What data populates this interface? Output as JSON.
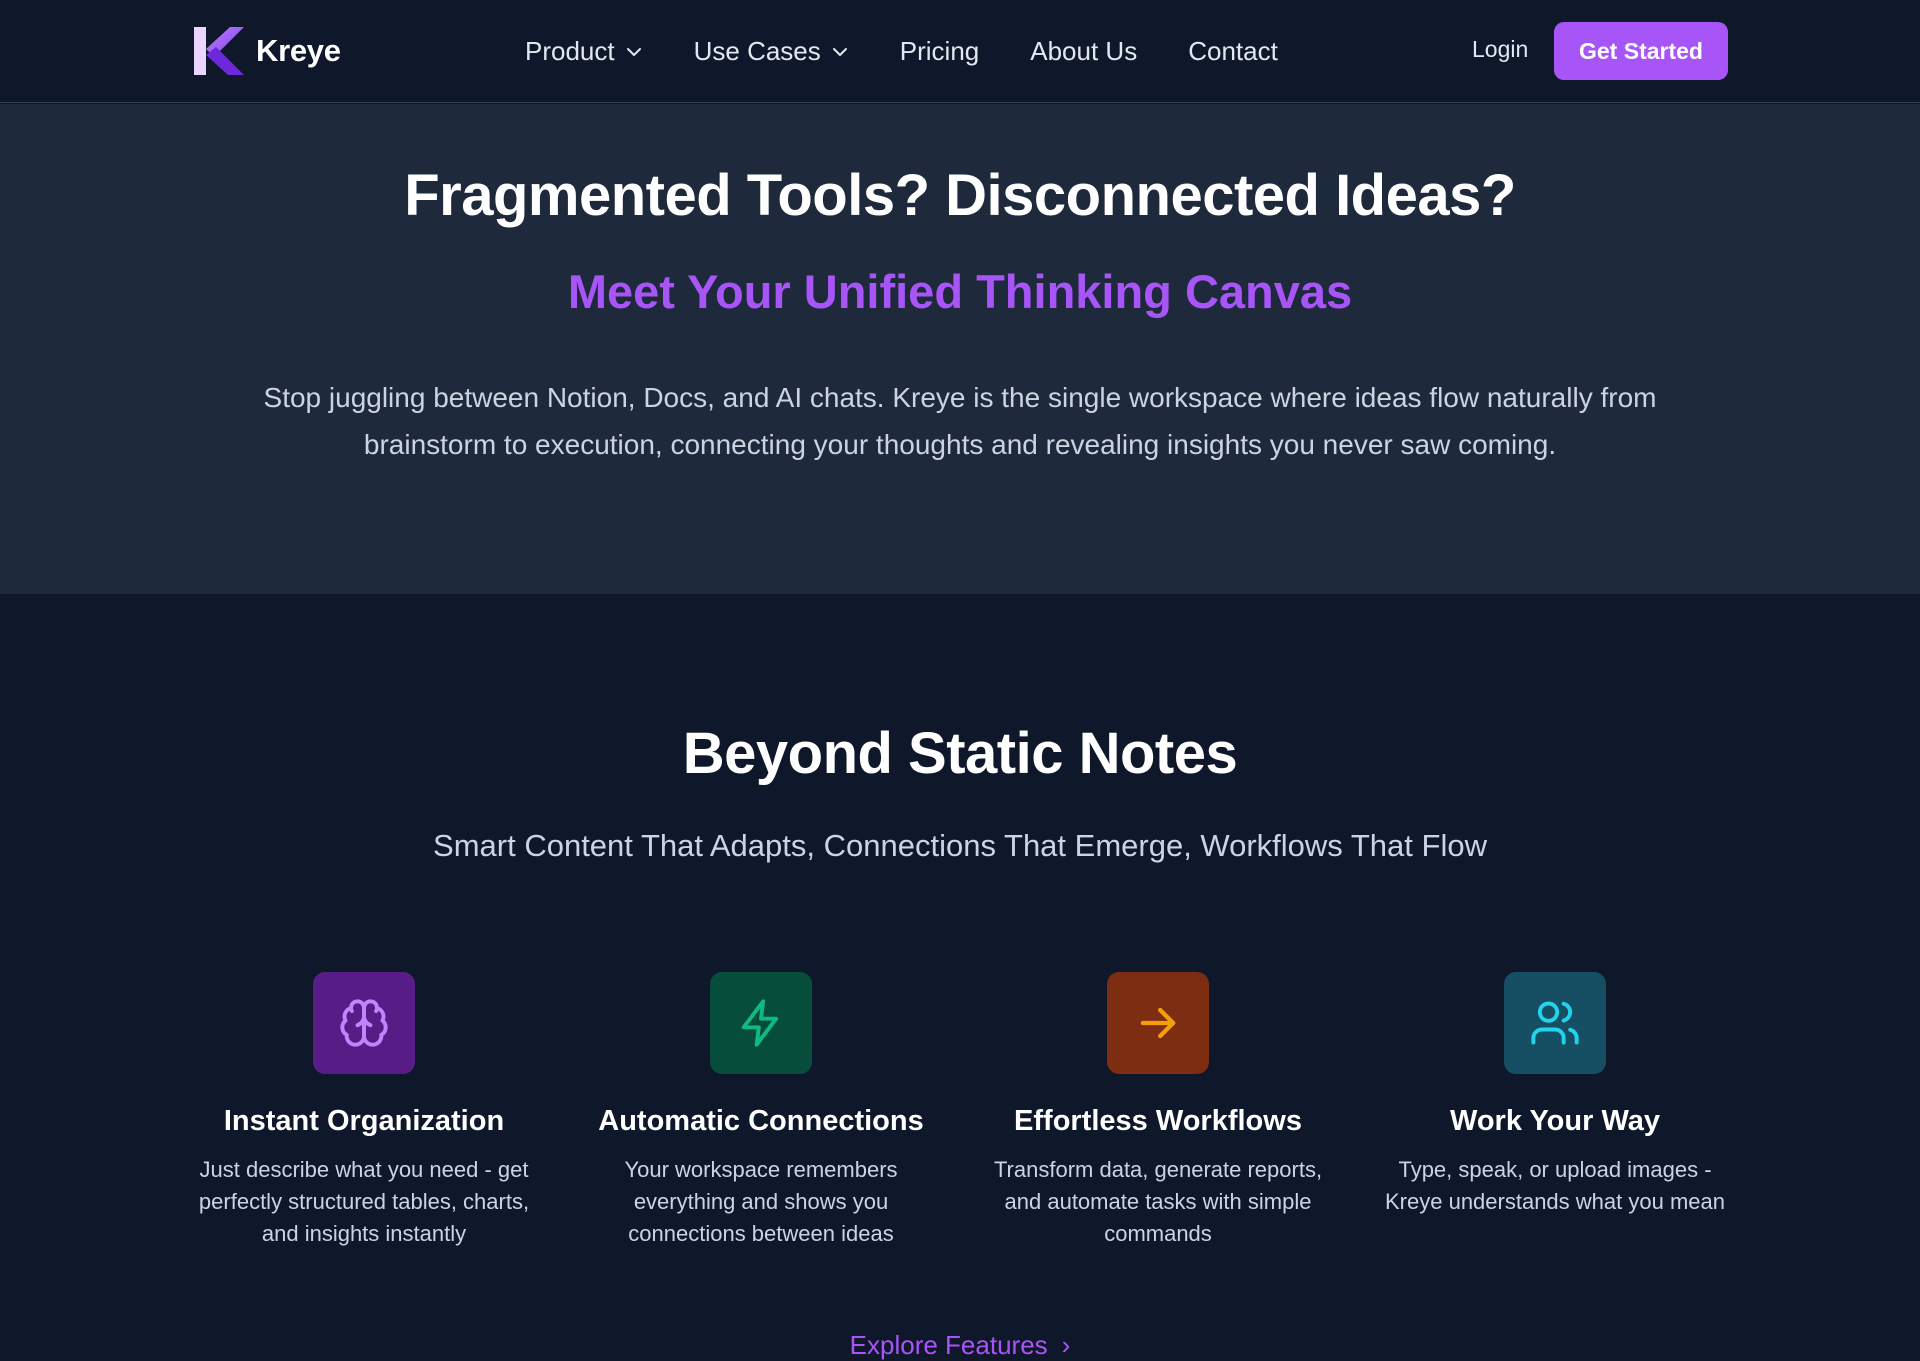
{
  "nav": {
    "brand": "Kreye",
    "items": [
      {
        "label": "Product"
      },
      {
        "label": "Use Cases"
      },
      {
        "label": "Pricing"
      },
      {
        "label": "About Us"
      },
      {
        "label": "Contact"
      }
    ],
    "login": "Login",
    "cta": "Get Started"
  },
  "hero": {
    "title": "Fragmented Tools? Disconnected Ideas?",
    "subtitle": "Meet Your Unified Thinking Canvas",
    "description": "Stop juggling between Notion, Docs, and AI chats. Kreye is the single workspace where ideas flow naturally from brainstorm to execution, connecting your thoughts and revealing insights you never saw coming."
  },
  "features": {
    "title": "Beyond Static Notes",
    "subtitle": "Smart Content That Adapts, Connections That Emerge, Workflows That Flow",
    "cards": [
      {
        "icon": "brain-icon",
        "title": "Instant Organization",
        "text": "Just describe what you need - get perfectly structured tables, charts, and insights instantly",
        "icon_color": "#c084fc",
        "box_color": "#581c87"
      },
      {
        "icon": "lightning-icon",
        "title": "Automatic Connections",
        "text": "Your workspace remembers everything and shows you connections between ideas",
        "icon_color": "#10b981",
        "box_color": "#064e3b"
      },
      {
        "icon": "arrow-right-icon",
        "title": "Effortless Workflows",
        "text": "Transform data, generate reports, and automate tasks with simple commands",
        "icon_color": "#f59e0b",
        "box_color": "#7c2d12"
      },
      {
        "icon": "users-icon",
        "title": "Work Your Way",
        "text": "Type, speak, or upload images - Kreye understands what you mean",
        "icon_color": "#22d3ee",
        "box_color": "#164e63"
      }
    ],
    "explore": "Explore Features"
  },
  "colors": {
    "accent": "#a855f7",
    "nav_bg": "#0f172a",
    "hero_bg": "#1e293b"
  }
}
